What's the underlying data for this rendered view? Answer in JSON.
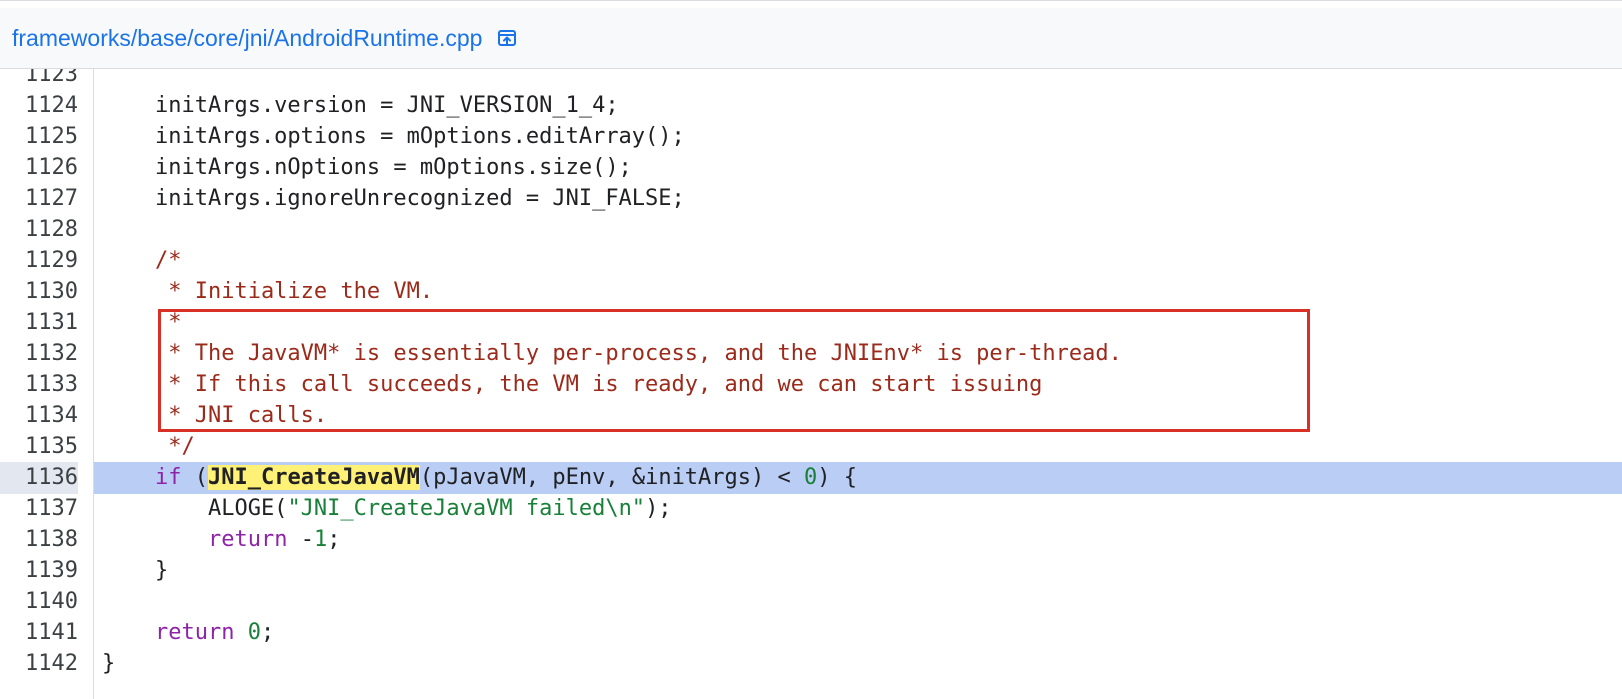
{
  "header": {
    "file_path": "frameworks/base/core/jni/AndroidRuntime.cpp",
    "open_icon": "open-in-new-icon"
  },
  "code": {
    "highlighted_line": "1136",
    "lines": [
      {
        "num": "1123",
        "segments": [
          {
            "t": "",
            "c": ""
          }
        ]
      },
      {
        "num": "1124",
        "segments": [
          {
            "t": "    initArgs.version = JNI_VERSION_1_4;",
            "c": ""
          }
        ]
      },
      {
        "num": "1125",
        "segments": [
          {
            "t": "    initArgs.options = mOptions.editArray();",
            "c": ""
          }
        ]
      },
      {
        "num": "1126",
        "segments": [
          {
            "t": "    initArgs.nOptions = mOptions.size();",
            "c": ""
          }
        ]
      },
      {
        "num": "1127",
        "segments": [
          {
            "t": "    initArgs.ignoreUnrecognized = JNI_FALSE;",
            "c": ""
          }
        ]
      },
      {
        "num": "1128",
        "segments": [
          {
            "t": "",
            "c": ""
          }
        ]
      },
      {
        "num": "1129",
        "segments": [
          {
            "t": "    /*",
            "c": "comment"
          }
        ]
      },
      {
        "num": "1130",
        "segments": [
          {
            "t": "     * Initialize the VM.",
            "c": "comment"
          }
        ]
      },
      {
        "num": "1131",
        "segments": [
          {
            "t": "     *",
            "c": "comment"
          }
        ]
      },
      {
        "num": "1132",
        "segments": [
          {
            "t": "     * The JavaVM* is essentially per-process, and the JNIEnv* is per-thread.",
            "c": "comment"
          }
        ]
      },
      {
        "num": "1133",
        "segments": [
          {
            "t": "     * If this call succeeds, the VM is ready, and we can start issuing",
            "c": "comment"
          }
        ]
      },
      {
        "num": "1134",
        "segments": [
          {
            "t": "     * JNI calls.",
            "c": "comment"
          }
        ]
      },
      {
        "num": "1135",
        "segments": [
          {
            "t": "     */",
            "c": "comment"
          }
        ]
      },
      {
        "num": "1136",
        "segments": [
          {
            "t": "    ",
            "c": ""
          },
          {
            "t": "if",
            "c": "kw"
          },
          {
            "t": " (",
            "c": ""
          },
          {
            "t": "JNI_CreateJavaVM",
            "c": "fn-hl"
          },
          {
            "t": "(pJavaVM, pEnv, &initArgs) < ",
            "c": ""
          },
          {
            "t": "0",
            "c": "num"
          },
          {
            "t": ") {",
            "c": ""
          }
        ]
      },
      {
        "num": "1137",
        "segments": [
          {
            "t": "        ALOGE(",
            "c": ""
          },
          {
            "t": "\"JNI_CreateJavaVM failed\\n\"",
            "c": "str"
          },
          {
            "t": ");",
            "c": ""
          }
        ]
      },
      {
        "num": "1138",
        "segments": [
          {
            "t": "        ",
            "c": ""
          },
          {
            "t": "return",
            "c": "kw"
          },
          {
            "t": " -",
            "c": ""
          },
          {
            "t": "1",
            "c": "num"
          },
          {
            "t": ";",
            "c": ""
          }
        ]
      },
      {
        "num": "1139",
        "segments": [
          {
            "t": "    }",
            "c": ""
          }
        ]
      },
      {
        "num": "1140",
        "segments": [
          {
            "t": "",
            "c": ""
          }
        ]
      },
      {
        "num": "1141",
        "segments": [
          {
            "t": "    ",
            "c": ""
          },
          {
            "t": "return",
            "c": "kw"
          },
          {
            "t": " ",
            "c": ""
          },
          {
            "t": "0",
            "c": "num"
          },
          {
            "t": ";",
            "c": ""
          }
        ]
      },
      {
        "num": "1142",
        "segments": [
          {
            "t": "}",
            "c": ""
          }
        ]
      }
    ]
  }
}
